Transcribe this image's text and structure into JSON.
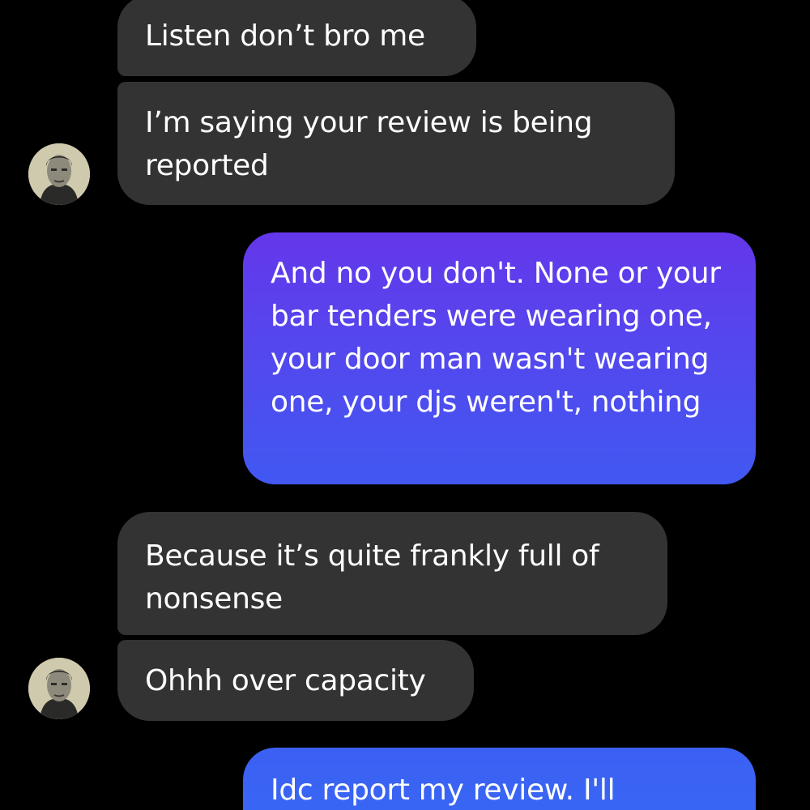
{
  "conversation": {
    "messages": [
      {
        "direction": "received",
        "text": "Listen don’t bro me"
      },
      {
        "direction": "received",
        "text": "I’m saying your review is being reported"
      },
      {
        "direction": "sent",
        "text": "And no you don't. None or your bar tenders were wearing one, your door man wasn't wearing one, your djs weren't, nothing"
      },
      {
        "direction": "received",
        "text": "Because it’s quite frankly full of nonsense"
      },
      {
        "direction": "received",
        "text": "Ohhh over capacity"
      },
      {
        "direction": "sent",
        "text": "Idc report my review. I'll"
      }
    ]
  },
  "colors": {
    "background": "#000000",
    "received_bubble": "#333333",
    "sent_bubble_top": "#6437ea",
    "sent_bubble_bottom": "#3768f4",
    "text": "#ffffff"
  },
  "icons": {
    "avatar": "contact-avatar"
  }
}
